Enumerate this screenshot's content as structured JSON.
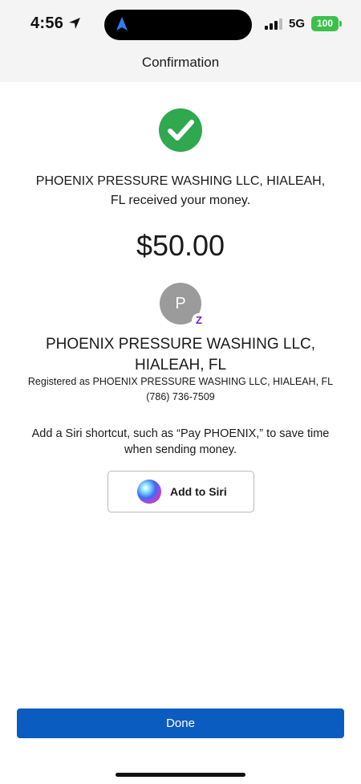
{
  "status_bar": {
    "time": "4:56",
    "network": "5G",
    "battery": "100"
  },
  "header": {
    "title": "Confirmation"
  },
  "confirmation": {
    "message_line1": "PHOENIX PRESSURE WASHING LLC, HIALEAH,",
    "message_line2": "FL received your money.",
    "amount": "$50.00"
  },
  "recipient": {
    "avatar_initial": "P",
    "badge": "Z",
    "name_line1": "PHOENIX PRESSURE WASHING LLC,",
    "name_line2": "HIALEAH, FL",
    "registered": "Registered as PHOENIX PRESSURE WASHING LLC, HIALEAH, FL",
    "phone": "(786) 736-7509"
  },
  "siri": {
    "prompt_line1": "Add a Siri shortcut, such as “Pay PHOENIX,” to save time",
    "prompt_line2": "when sending money.",
    "button_label": "Add to Siri"
  },
  "footer": {
    "done_label": "Done"
  },
  "colors": {
    "success_green": "#2fa84f",
    "primary_blue": "#0b5cc0",
    "zelle_purple": "#6d1ed4",
    "battery_green": "#3dc04b"
  }
}
